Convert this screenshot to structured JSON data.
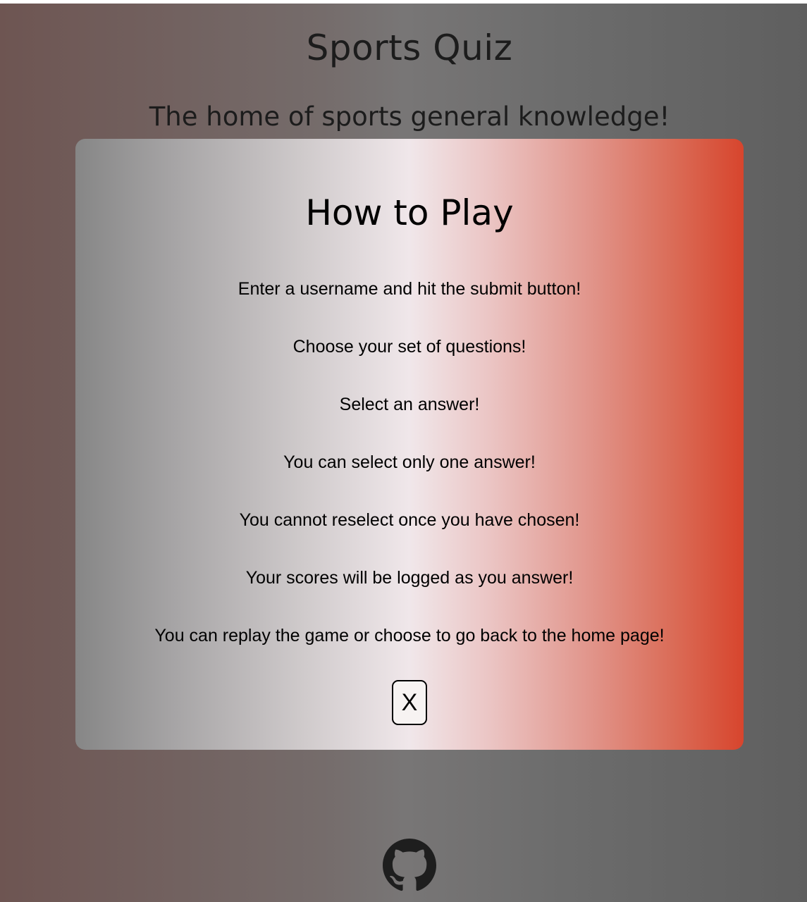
{
  "header": {
    "title": "Sports Quiz",
    "subtitle": "The home of sports general knowledge!"
  },
  "modal": {
    "heading": "How to Play",
    "instructions": [
      "Enter a username and hit the submit button!",
      "Choose your set of questions!",
      "Select an answer!",
      "You can select only one answer!",
      "You cannot reselect once you have chosen!",
      "Your scores will be logged as you answer!",
      "You can replay the game or choose to go back to the home page!"
    ],
    "close_label": "X"
  },
  "footer": {
    "icon": "github-icon"
  },
  "colors": {
    "page_gradient": [
      "#6e5552",
      "#5f5f5f"
    ],
    "modal_gradient": [
      "#868686",
      "#f0e7ea",
      "#d7452d"
    ],
    "text": "#1c1c1c"
  }
}
